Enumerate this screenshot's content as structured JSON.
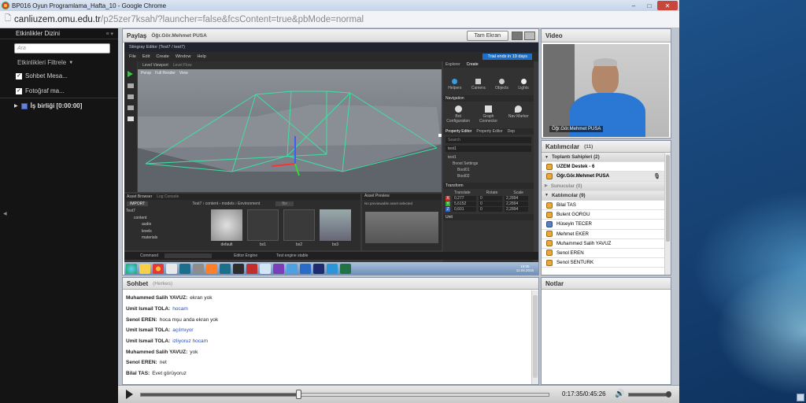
{
  "window": {
    "title": "BP016 Oyun Programlama_Hafta_10 - Google Chrome",
    "controls": [
      "–",
      "□",
      "✕"
    ]
  },
  "address": {
    "host": "canliuzem.omu.edu.tr",
    "path": "/p25zer7ksah/?launcher=false&fcsContent=true&pbMode=normal"
  },
  "sidebar": {
    "title": "Etkinlikler Dizini",
    "menu_glyph": "≡ ▾",
    "search_placeholder": "Ara",
    "filter_label": "Etkinlikleri Filtrele",
    "checks": [
      {
        "label": "Sohbet Mesa..."
      },
      {
        "label": "Fotoğraf ma..."
      }
    ],
    "event": "İş birliği [0:00:00]"
  },
  "share": {
    "title": "Paylaş",
    "presenter": "Öğr.Gör.Mehmet PUSA",
    "fullscreen": "Tam Ekran"
  },
  "editor": {
    "title": "Stingray Editor (Test7 / test7)",
    "menus": [
      "File",
      "Edit",
      "Create",
      "Window",
      "Help"
    ],
    "viewport_tab": "Level Viewport",
    "level_flow_tab": "Level Flow",
    "viewport_btns": [
      "Persp",
      "Full Render",
      "View"
    ],
    "trial": "Trial ends in 19 days",
    "explorer_tabs": [
      "Explorer",
      "Create"
    ],
    "create_items": [
      "Helpers",
      "Camera",
      "Objects",
      "Lights"
    ],
    "navigation_header": "Navigation",
    "nav_items": [
      "Bot Configuration",
      "Graph Connector",
      "Nav Marker"
    ],
    "property_tabs": [
      "Property Editor",
      "Property Editor",
      "Dep"
    ],
    "search": "Search",
    "prop_name": "test1",
    "prop_tree": [
      "test1",
      "Boost Settings",
      "Bool01",
      "Bool02"
    ],
    "transform_header": "Transform",
    "transform_cols": [
      "Translate",
      "Rotate",
      "Scale"
    ],
    "transform_rows": [
      {
        "axis": "X",
        "t": "0,277",
        "r": "0",
        "s": "2,2894"
      },
      {
        "axis": "Y",
        "t": "5,6152",
        "r": "0",
        "s": "2,2894"
      },
      {
        "axis": "Z",
        "t": "0,601",
        "r": "0",
        "s": "2,2894"
      }
    ],
    "unit_header": "Unit",
    "asset_browser_tab": "Asset Browser",
    "log_console_tab": "Log Console",
    "import_btn": "IMPORT",
    "breadcrumb": "Test7 › content › models › Environment",
    "filter_tag": "fbx",
    "folders": [
      "Test7",
      "content",
      "audio",
      "levels",
      "materials"
    ],
    "assets": [
      "default",
      "bx1",
      "bx2",
      "bx3"
    ],
    "asset_preview_tab": "Asset Preview",
    "preview_msg": "No previewable asset selected",
    "command_label": "Command",
    "editor_engine": "Editor Engine",
    "status_msg": "Test engine stable",
    "clock_time": "19:05",
    "clock_date": "11.04.2016"
  },
  "video": {
    "title": "Video",
    "label": "Öğr.Gör.Mehmet PUSA"
  },
  "participants": {
    "title": "Katılımcılar",
    "count": "(11)",
    "groups": [
      {
        "label": "Toplantı Sahipleri (2)",
        "members": [
          "UZEM Destek - 6",
          "Öğr.Gör.Mehmet PUSA"
        ]
      },
      {
        "label": "Sunucular (0)",
        "members": []
      },
      {
        "label": "Katılımcılar (9)",
        "members": [
          "Bilal TAS",
          "Bulent GORGU",
          "Hüseyin TECER",
          "Mehmet EKER",
          "Muhammed Salih YAVUZ",
          "Senol EREN",
          "Senol SENTURK"
        ]
      }
    ]
  },
  "chat": {
    "title": "Sohbet",
    "scope": "(Herkes)",
    "messages": [
      {
        "author": "Muhammed Salih YAVUZ:",
        "text": "ekran yok",
        "highlight": false
      },
      {
        "author": "Umit Ismail TOLA:",
        "text": "hocam",
        "highlight": true
      },
      {
        "author": "Senol EREN:",
        "text": "hoca mşu anda ekran yok",
        "highlight": false
      },
      {
        "author": "Umit Ismail TOLA:",
        "text": "açılmıyor",
        "highlight": true
      },
      {
        "author": "Umit Ismail TOLA:",
        "text": "izliyoruz hocam",
        "highlight": true
      },
      {
        "author": "Muhammed Salih YAVUZ:",
        "text": "yok",
        "highlight": false
      },
      {
        "author": "Senol EREN:",
        "text": "net",
        "highlight": false
      },
      {
        "author": "Bilal TAS:",
        "text": "Evet görüyoruz",
        "highlight": false
      }
    ]
  },
  "notes": {
    "title": "Notlar"
  },
  "player": {
    "time": "0:17:35/0:45:26",
    "progress": 0.387,
    "volume": 0.95
  },
  "colors": {
    "sidebar_bg": "#141414",
    "panel_border": "#8a93a3",
    "chat_highlight": "#2a4fb0",
    "lock_icon": "#e7a93a",
    "editor_accent": "#1e6fc7",
    "wireframe": "#3ee0a0"
  }
}
